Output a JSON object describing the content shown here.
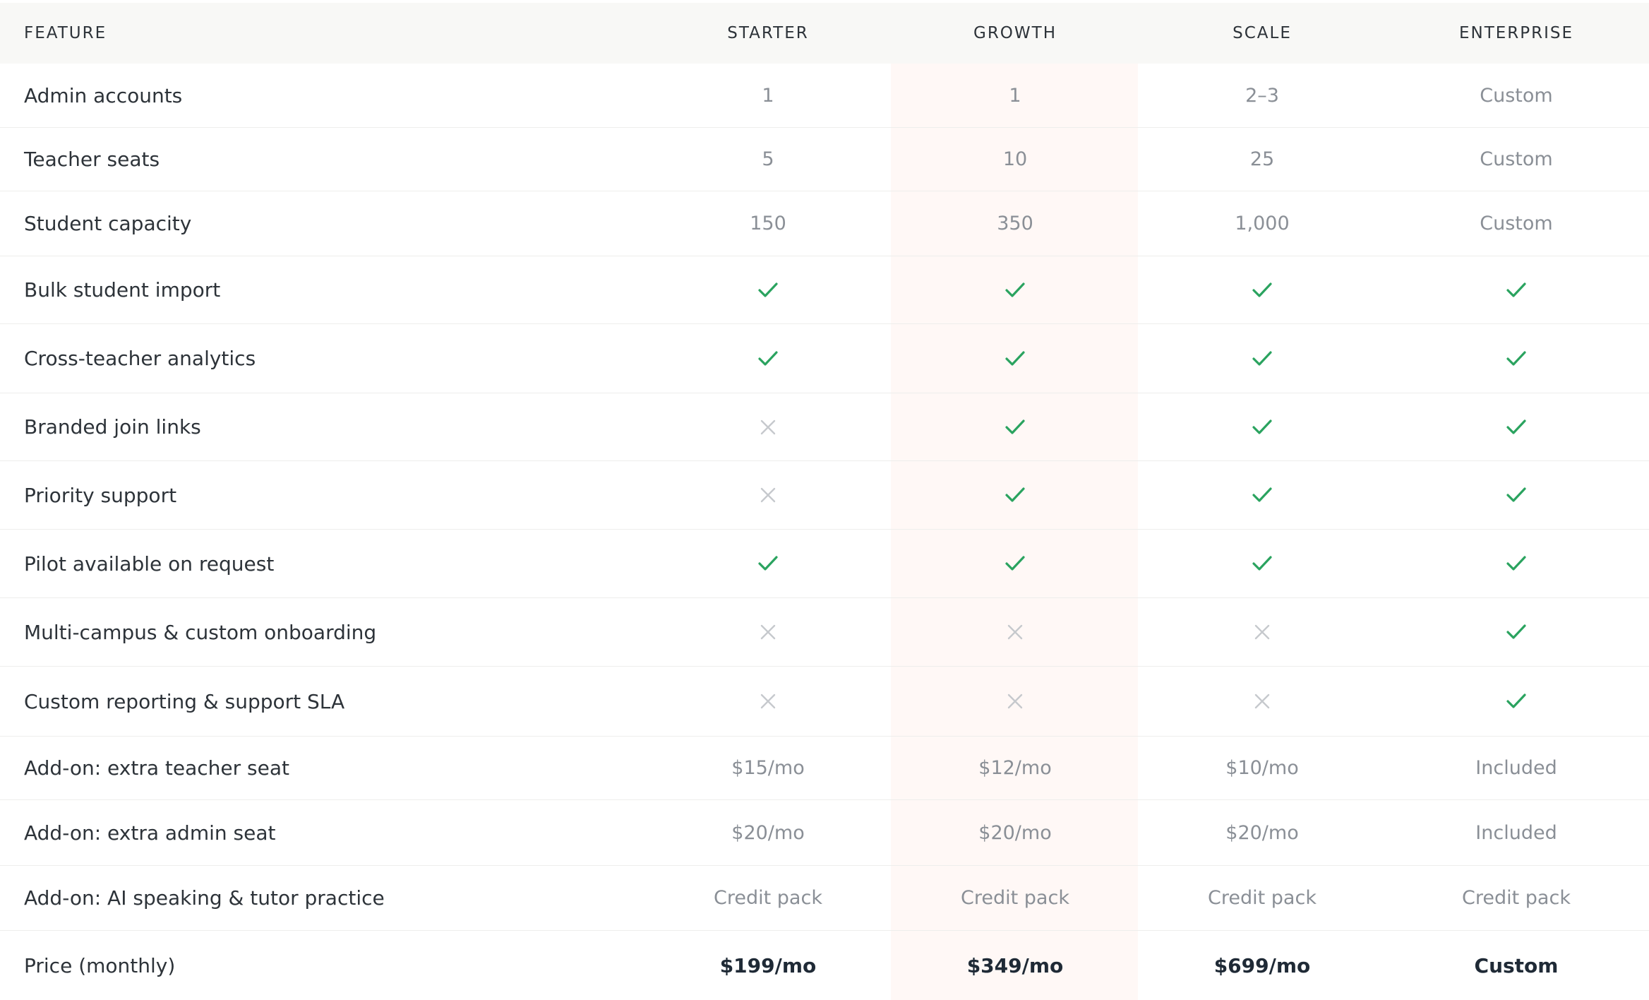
{
  "header": {
    "feature": "FEATURE",
    "plans": [
      "STARTER",
      "GROWTH",
      "SCALE",
      "ENTERPRISE"
    ]
  },
  "rows": [
    {
      "feature": "Admin accounts",
      "values": [
        "1",
        "1",
        "2–3",
        "Custom"
      ]
    },
    {
      "feature": "Teacher seats",
      "values": [
        "5",
        "10",
        "25",
        "Custom"
      ]
    },
    {
      "feature": "Student capacity",
      "values": [
        "150",
        "350",
        "1,000",
        "Custom"
      ]
    },
    {
      "feature": "Bulk student import",
      "values": [
        "check",
        "check",
        "check",
        "check"
      ]
    },
    {
      "feature": "Cross-teacher analytics",
      "values": [
        "check",
        "check",
        "check",
        "check"
      ]
    },
    {
      "feature": "Branded join links",
      "values": [
        "cross",
        "check",
        "check",
        "check"
      ]
    },
    {
      "feature": "Priority support",
      "values": [
        "cross",
        "check",
        "check",
        "check"
      ]
    },
    {
      "feature": "Pilot available on request",
      "values": [
        "check",
        "check",
        "check",
        "check"
      ]
    },
    {
      "feature": "Multi-campus & custom onboarding",
      "values": [
        "cross",
        "cross",
        "cross",
        "check"
      ]
    },
    {
      "feature": "Custom reporting & support SLA",
      "values": [
        "cross",
        "cross",
        "cross",
        "check"
      ]
    },
    {
      "feature": "Add-on: extra teacher seat",
      "values": [
        "$15/mo",
        "$12/mo",
        "$10/mo",
        "Included"
      ]
    },
    {
      "feature": "Add-on: extra admin seat",
      "values": [
        "$20/mo",
        "$20/mo",
        "$20/mo",
        "Included"
      ]
    },
    {
      "feature": "Add-on: AI speaking & tutor practice",
      "values": [
        "Credit pack",
        "Credit pack",
        "Credit pack",
        "Credit pack"
      ]
    },
    {
      "feature": "Price (monthly)",
      "values": [
        "$199/mo",
        "$349/mo",
        "$699/mo",
        "Custom"
      ]
    }
  ],
  "icons": {
    "check": "check-icon",
    "cross": "cross-icon"
  },
  "colors": {
    "check": "#2aa35f",
    "cross": "#c6c9cd",
    "highlight_column": "#fff8f6",
    "header_background": "#f8f8f6"
  }
}
